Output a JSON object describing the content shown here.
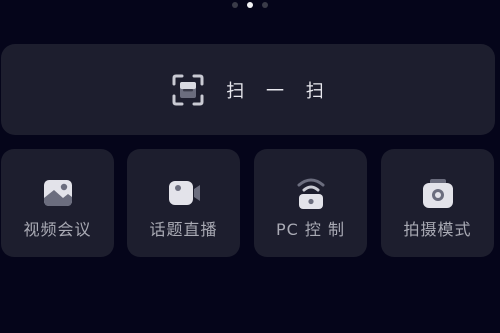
{
  "pager": {
    "pages": 3,
    "active_index": 1
  },
  "scan": {
    "label": "扫 一 扫",
    "icon": "scan-icon"
  },
  "tiles": [
    {
      "label": "视频会议",
      "icon": "image-icon"
    },
    {
      "label": "话题直播",
      "icon": "video-camera-icon"
    },
    {
      "label": "PC 控 制",
      "icon": "wifi-lock-icon"
    },
    {
      "label": "拍摄模式",
      "icon": "camera-icon"
    }
  ],
  "colors": {
    "background": "#05051a",
    "card": "#1d1e2e",
    "label": "#a9aab4",
    "scan_label": "#e8e8ee",
    "icon_light": "#e3e3ea",
    "icon_dark": "#6b6d7e"
  }
}
